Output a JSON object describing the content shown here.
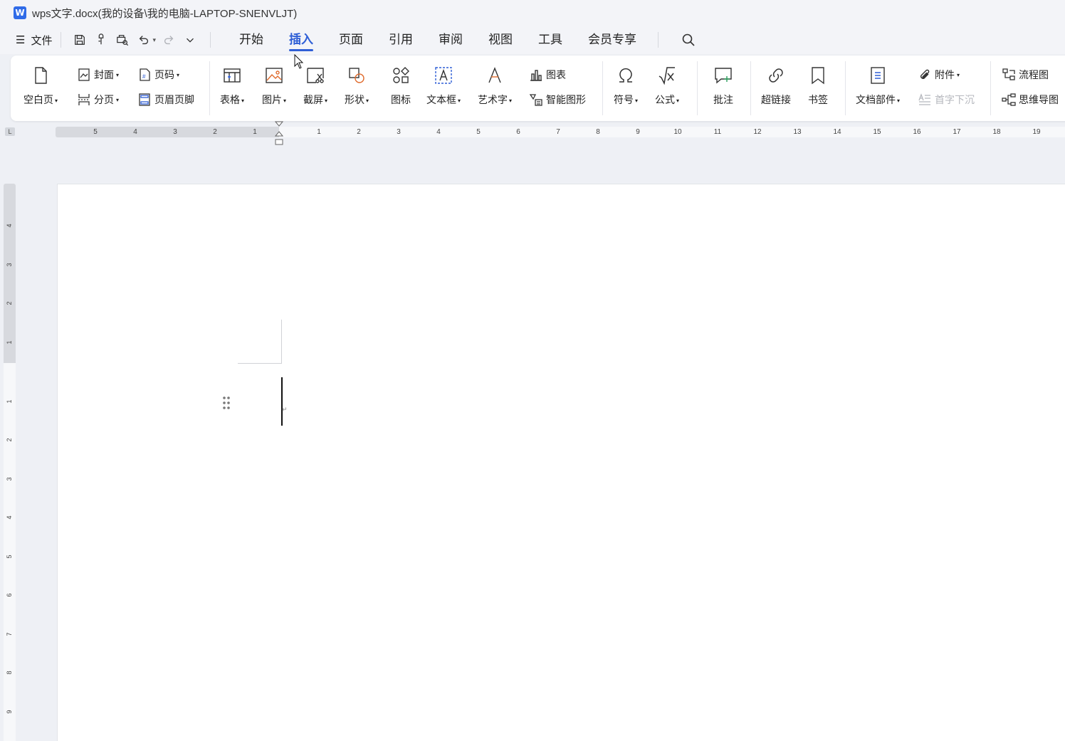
{
  "titlebar": {
    "logo_letter": "W",
    "title": "wps文字.docx(我的设备\\我的电脑-LAPTOP-SNENVLJT)"
  },
  "menubar": {
    "file_label": "文件",
    "tabs": [
      {
        "label": "开始",
        "active": false
      },
      {
        "label": "插入",
        "active": true
      },
      {
        "label": "页面",
        "active": false
      },
      {
        "label": "引用",
        "active": false
      },
      {
        "label": "审阅",
        "active": false
      },
      {
        "label": "视图",
        "active": false
      },
      {
        "label": "工具",
        "active": false
      },
      {
        "label": "会员专享",
        "active": false
      }
    ]
  },
  "ribbon": {
    "blank_page": "空白页",
    "cover": "封面",
    "page_break": "分页",
    "page_number": "页码",
    "header_footer": "页眉页脚",
    "table": "表格",
    "picture": "图片",
    "screenshot": "截屏",
    "shape": "形状",
    "icons": "图标",
    "textbox": "文本框",
    "wordart": "艺术字",
    "chart": "图表",
    "smart_graphic": "智能图形",
    "symbol": "符号",
    "formula": "公式",
    "comment": "批注",
    "hyperlink": "超链接",
    "bookmark": "书签",
    "doc_parts": "文档部件",
    "attachment": "附件",
    "drop_cap": "首字下沉",
    "flowchart": "流程图",
    "mindmap": "思维导图"
  },
  "ruler": {
    "corner": "L",
    "left_numbers": [
      "5",
      "4",
      "3",
      "2",
      "1"
    ],
    "right_numbers": [
      "1",
      "2",
      "3",
      "4",
      "5",
      "6",
      "7",
      "8",
      "9",
      "10",
      "11",
      "12",
      "13",
      "14",
      "15",
      "16",
      "17",
      "18",
      "19"
    ],
    "vertical_top": [
      "4",
      "3",
      "2",
      "1"
    ],
    "vertical_bottom": [
      "1",
      "2",
      "3",
      "4",
      "5",
      "6",
      "7",
      "8",
      "9"
    ]
  },
  "colors": {
    "accent": "#2f5fd6",
    "logo": "#2f6be8",
    "icon_accent": "#e06b2d"
  }
}
